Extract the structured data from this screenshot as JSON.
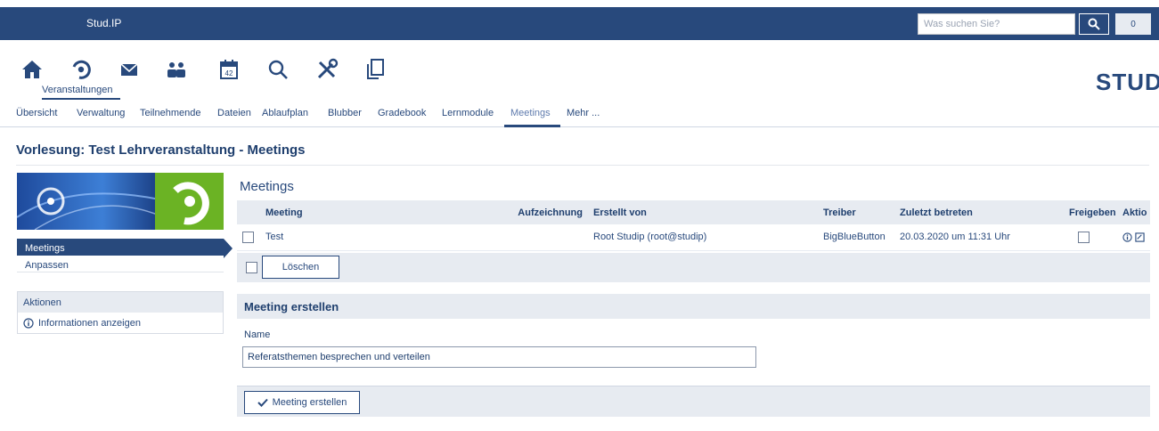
{
  "topbar": {
    "brand": "Stud.IP",
    "search_placeholder": "Was suchen Sie?",
    "notifications": "0"
  },
  "nav": {
    "icons": [
      "home-icon",
      "dashboard-icon",
      "mail-icon",
      "community-icon",
      "calendar-icon",
      "search-icon",
      "tools-icon",
      "files-icon"
    ],
    "calendar_day": "42",
    "active_label": "Veranstaltungen",
    "logo": "STUDIP"
  },
  "tabs": [
    "Übersicht",
    "Verwaltung",
    "Teilnehmende",
    "Dateien",
    "Ablaufplan",
    "Blubber",
    "Gradebook",
    "Lernmodule",
    "Meetings",
    "Mehr ..."
  ],
  "page_title": "Vorlesung: Test Lehrveranstaltung - Meetings",
  "sidebar": {
    "nav": [
      "Meetings",
      "Anpassen"
    ],
    "actions_title": "Aktionen",
    "action_info": "Informationen anzeigen"
  },
  "meetings": {
    "title": "Meetings",
    "columns": [
      "Meeting",
      "Aufzeichnung",
      "Erstellt von",
      "Treiber",
      "Zuletzt betreten",
      "Freigeben",
      "Aktio"
    ],
    "rows": [
      {
        "meeting": "Test",
        "recording": "",
        "created_by": "Root Studip (root@studip)",
        "driver": "BigBlueButton",
        "last_entered": "20.03.2020 um 11:31 Uhr"
      }
    ],
    "delete_button": "Löschen"
  },
  "create": {
    "title": "Meeting erstellen",
    "name_label": "Name",
    "name_value": "Referatsthemen besprechen und verteilen",
    "submit": "Meeting erstellen"
  },
  "colors": {
    "primary": "#28497c",
    "light": "#e7ebf1",
    "logo_green": "#6bb324"
  }
}
